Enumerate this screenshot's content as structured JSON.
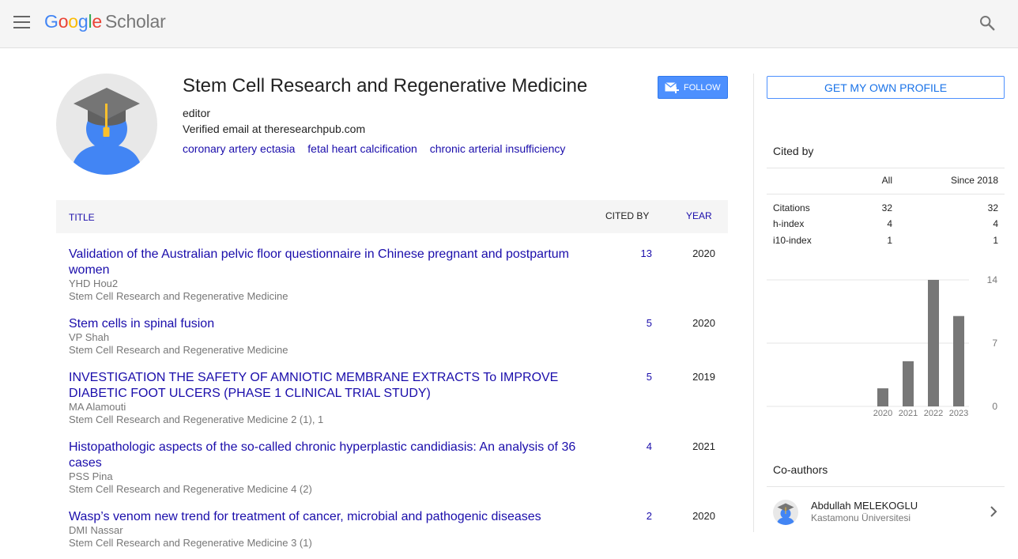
{
  "header": {
    "logo_letters": [
      "G",
      "o",
      "o",
      "g",
      "l",
      "e"
    ],
    "logo_word": "Scholar"
  },
  "profile": {
    "name": "Stem Cell Research and Regenerative Medicine",
    "affiliation": "editor",
    "email": "Verified email at theresearchpub.com",
    "interests": [
      "coronary artery ectasia",
      "fetal heart calcification",
      "chronic arterial insufficiency"
    ],
    "follow_label": "FOLLOW"
  },
  "table": {
    "col_title": "TITLE",
    "col_cited": "CITED BY",
    "col_year": "YEAR",
    "rows": [
      {
        "title": "Validation of the Australian pelvic floor questionnaire in Chinese pregnant and postpartum women",
        "authors": "YHD Hou2",
        "venue": "Stem Cell Research and Regenerative Medicine",
        "cited": "13",
        "year": "2020"
      },
      {
        "title": "Stem cells in spinal fusion",
        "authors": "VP Shah",
        "venue": "Stem Cell Research and Regenerative Medicine",
        "cited": "5",
        "year": "2020"
      },
      {
        "title": "INVESTIGATION THE SAFETY OF AMNIOTIC MEMBRANE EXTRACTS To IMPROVE DIABETIC FOOT ULCERS (PHASE 1 CLINICAL TRIAL STUDY)",
        "authors": "MA Alamouti",
        "venue": "Stem Cell Research and Regenerative Medicine 2 (1), 1",
        "cited": "5",
        "year": "2019"
      },
      {
        "title": "Histopathologic aspects of the so-called chronic hyperplastic candidiasis: An analysis of 36 cases",
        "authors": "PSS Pina",
        "venue": "Stem Cell Research and Regenerative Medicine 4 (2)",
        "cited": "4",
        "year": "2021"
      },
      {
        "title": "Wasp’s venom new trend for treatment of cancer, microbial and pathogenic diseases",
        "authors": "DMI Nassar",
        "venue": "Stem Cell Research and Regenerative Medicine 3 (1)",
        "cited": "2",
        "year": "2020"
      }
    ]
  },
  "sidebar": {
    "get_profile_label": "GET MY OWN PROFILE",
    "cited_by_heading": "Cited by",
    "col_all": "All",
    "col_since": "Since 2018",
    "stats": [
      {
        "label": "Citations",
        "all": "32",
        "since": "32"
      },
      {
        "label": "h-index",
        "all": "4",
        "since": "4"
      },
      {
        "label": "i10-index",
        "all": "1",
        "since": "1"
      }
    ],
    "coauthors_heading": "Co-authors",
    "coauthors": [
      {
        "name": "Abdullah MELEKOGLU",
        "affiliation": "Kastamonu Üniversitesi"
      }
    ]
  },
  "colors": {
    "link": "#1a0dab",
    "follow_bg": "#4d90fe",
    "bar": "#777777"
  },
  "chart_data": {
    "type": "bar",
    "categories": [
      "2020",
      "2021",
      "2022",
      "2023"
    ],
    "values": [
      2,
      5,
      14,
      10
    ],
    "ylim": [
      0,
      14
    ],
    "yticks": [
      "14",
      "7",
      "0"
    ],
    "grid": true
  }
}
